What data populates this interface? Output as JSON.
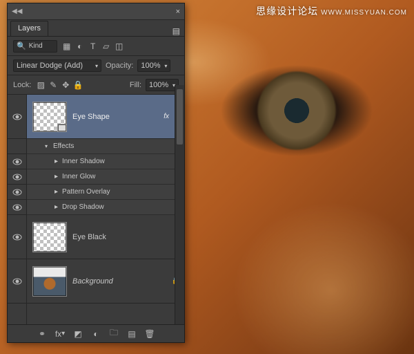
{
  "watermark": {
    "main": "思缘设计论坛",
    "sub": "WWW.MISSYUAN.COM"
  },
  "panel": {
    "title": "Layers",
    "filter": {
      "label": "Kind"
    },
    "blend_mode": "Linear Dodge (Add)",
    "opacity_label": "Opacity:",
    "opacity_value": "100%",
    "lock_label": "Lock:",
    "fill_label": "Fill:",
    "fill_value": "100%",
    "effects_label": "Effects",
    "effects": [
      "Inner Shadow",
      "Inner Glow",
      "Pattern Overlay",
      "Drop Shadow"
    ],
    "layers": [
      {
        "name": "Eye Shape",
        "has_fx": true,
        "selected": true,
        "thumb": "trans",
        "vector": true
      },
      {
        "name": "Eye Black",
        "thumb": "trans"
      },
      {
        "name": "Background",
        "locked": true,
        "italic": true,
        "thumb": "bg"
      }
    ],
    "fx_indicator": "fx",
    "footer_icons": [
      "link",
      "fx",
      "mask",
      "adjust",
      "group",
      "new",
      "trash"
    ]
  }
}
